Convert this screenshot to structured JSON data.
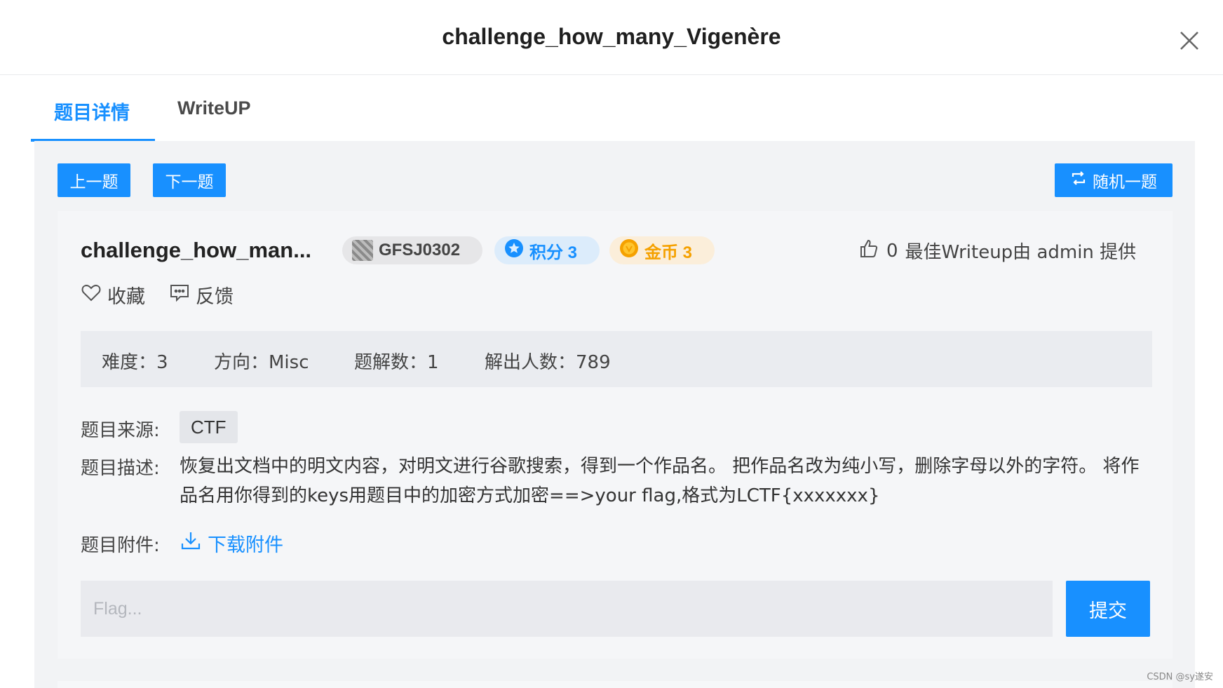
{
  "header": {
    "title": "challenge_how_many_Vigenère"
  },
  "tabs": [
    {
      "label": "题目详情"
    },
    {
      "label": "WriteUP"
    }
  ],
  "nav": {
    "prev_label": "上一题",
    "next_label": "下一题",
    "random_label": "随机一题"
  },
  "challenge": {
    "name": "challenge_how_man...",
    "code": "GFSJ0302",
    "score_label": "积分 3",
    "coin_label": "金币 3",
    "likes": "0",
    "best_writeup": "最佳Writeup由 admin 提供",
    "favorite_label": "收藏",
    "feedback_label": "反馈"
  },
  "stats": {
    "difficulty": "难度：3",
    "direction": "方向：Misc",
    "solutions": "题解数：1",
    "solvers": "解出人数：789"
  },
  "details": {
    "source_label": "题目来源:",
    "source_value": "CTF",
    "desc_label": "题目描述:",
    "desc_text": "恢复出文档中的明文内容，对明文进行谷歌搜索，得到一个作品名。 把作品名改为纯小写，删除字母以外的字符。 将作品名用你得到的keys用题目中的加密方式加密==>your flag,格式为LCTF{xxxxxxx}",
    "attach_label": "题目附件:",
    "download_label": "下载附件"
  },
  "flag": {
    "placeholder": "Flag...",
    "submit_label": "提交"
  },
  "watermark": "CSDN @sy遂安",
  "colors": {
    "accent": "#1890ff",
    "coin": "#f5a100"
  }
}
